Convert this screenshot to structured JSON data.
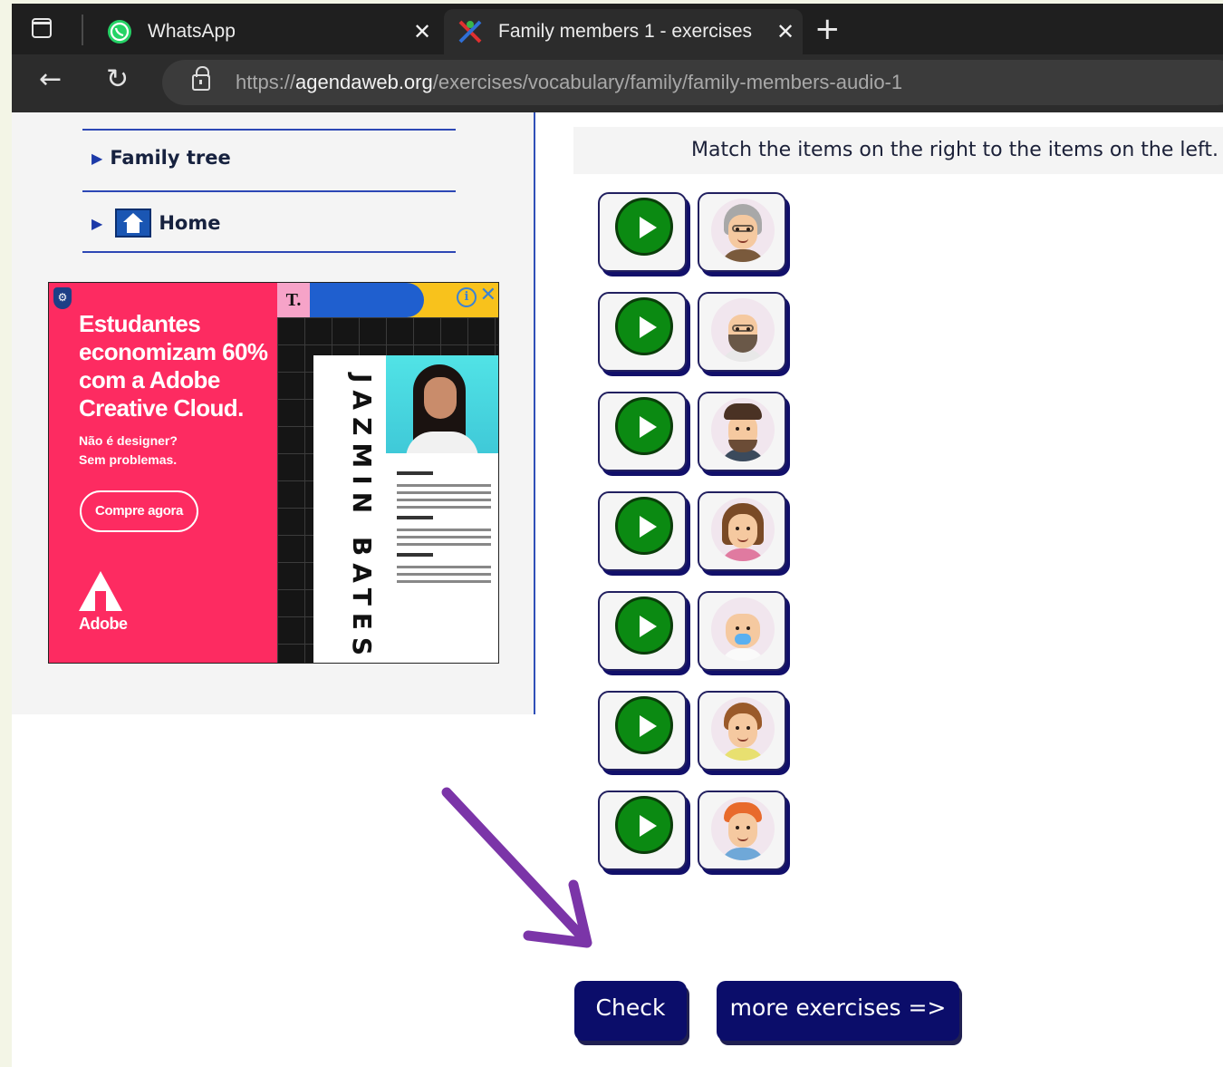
{
  "browser": {
    "tabs": [
      {
        "title": "WhatsApp",
        "active": false,
        "close": "✕",
        "favicon": "whatsapp-icon"
      },
      {
        "title": "Family members 1 - exercises",
        "active": true,
        "close": "✕",
        "favicon": "agendaweb-icon"
      }
    ],
    "new_tab_glyph": "+",
    "back_glyph": "←",
    "reload_glyph": "↻",
    "url_scheme": "https://",
    "url_domain": "agendaweb.org",
    "url_path": "/exercises/vocabulary/family/family-members-audio-1"
  },
  "sidebar": {
    "links": [
      {
        "label": "Family tree",
        "icon": "triangle-right-icon"
      },
      {
        "label": "Home",
        "icon": "home-icon"
      }
    ]
  },
  "ad": {
    "headline": "Estudantes economizam 60% com a Adobe Creative Cloud.",
    "sub_line1": "Não é designer?",
    "sub_line2": "Sem problemas.",
    "cta": "Compre agora",
    "brand": "Adobe",
    "corner_letter": "T.",
    "resume_name": "JAZMIN BATES",
    "accent": "#fd2b61"
  },
  "exercise": {
    "instruction": "Match the items on the right to the items on the left.",
    "pairs": [
      {
        "audio": "play-icon",
        "picture": "grandmother-avatar"
      },
      {
        "audio": "play-icon",
        "picture": "grandfather-avatar"
      },
      {
        "audio": "play-icon",
        "picture": "father-avatar"
      },
      {
        "audio": "play-icon",
        "picture": "mother-avatar"
      },
      {
        "audio": "play-icon",
        "picture": "baby-avatar"
      },
      {
        "audio": "play-icon",
        "picture": "sister-avatar"
      },
      {
        "audio": "play-icon",
        "picture": "brother-avatar"
      }
    ],
    "check_label": "Check",
    "more_label": "more exercises =>"
  },
  "colors": {
    "button_navy": "#0b0d6a",
    "play_green": "#0b8a12",
    "annotation_arrow": "#7b35a8"
  }
}
